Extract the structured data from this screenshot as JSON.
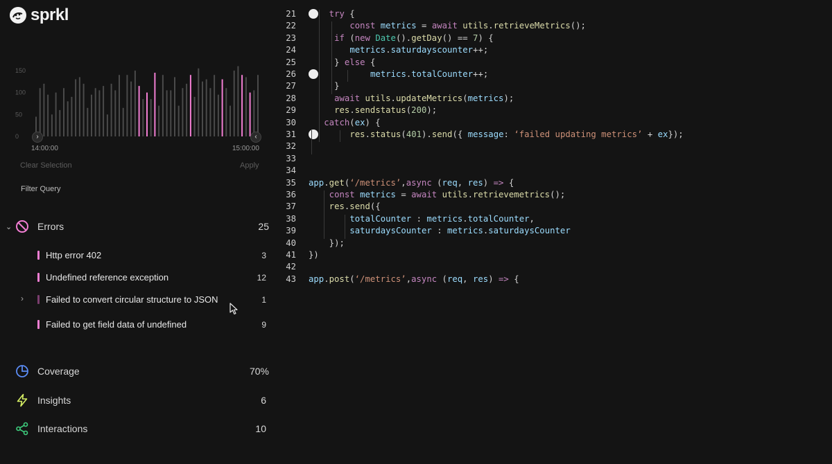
{
  "app": {
    "logo_text": "sprkl"
  },
  "chart_data": {
    "type": "bar",
    "y_ticks": [
      "150",
      "100",
      "50",
      "0"
    ],
    "ylim": [
      0,
      175
    ],
    "x_start_label": "14:00:00",
    "x_end_label": "15:00:00",
    "values": [
      45,
      110,
      120,
      95,
      50,
      100,
      60,
      110,
      80,
      90,
      130,
      135,
      120,
      65,
      95,
      110,
      105,
      115,
      50,
      120,
      105,
      140,
      65,
      140,
      125,
      150,
      115,
      85,
      100,
      85,
      145,
      70,
      140,
      105,
      105,
      135,
      70,
      110,
      120,
      140,
      90,
      155,
      125,
      130,
      110,
      140,
      95,
      130,
      110,
      70,
      150,
      160,
      140,
      135,
      100,
      105,
      140
    ],
    "highlight": [
      false,
      false,
      false,
      false,
      false,
      false,
      false,
      false,
      false,
      false,
      false,
      false,
      false,
      false,
      false,
      false,
      false,
      false,
      false,
      false,
      false,
      false,
      false,
      false,
      false,
      false,
      true,
      false,
      true,
      false,
      true,
      false,
      false,
      false,
      false,
      false,
      false,
      false,
      false,
      true,
      false,
      false,
      false,
      false,
      false,
      false,
      false,
      true,
      false,
      false,
      false,
      false,
      true,
      false,
      true,
      false,
      false
    ],
    "colors": {
      "normal": "#4a4a4a",
      "highlight": "#f27ed3"
    },
    "grid": false,
    "legend": "none"
  },
  "selection": {
    "clear_label": "Clear Selection",
    "apply_label": "Apply"
  },
  "filter": {
    "label": "Filter Query"
  },
  "errors": {
    "label": "Errors",
    "count": "25",
    "items": [
      {
        "label": "Http error 402",
        "count": "3",
        "bar_color": "#f27ed3"
      },
      {
        "label": "Undefined reference exception",
        "count": "12",
        "bar_color": "#f27ed3"
      },
      {
        "label": "Failed to convert circular structure to JSON",
        "count": "1",
        "bar_color": "#7a3d6e"
      },
      {
        "label": "Failed to get field data of undefined",
        "count": "9",
        "bar_color": "#f27ed3"
      }
    ]
  },
  "coverage": {
    "label": "Coverage",
    "value": "70%",
    "icon": "pie-icon",
    "color": "#5b8cf5"
  },
  "insights": {
    "label": "Insights",
    "value": "6",
    "icon": "lightning-icon",
    "color": "#d7f065"
  },
  "interactions": {
    "label": "Interactions",
    "value": "10",
    "icon": "share-icon",
    "color": "#3ecf7e"
  },
  "code": {
    "lines": [
      {
        "n": "21",
        "tokens": [
          [
            "kw",
            "try "
          ],
          [
            "pl",
            "{"
          ]
        ]
      },
      {
        "n": "22",
        "tokens": [
          [
            "kw",
            "const "
          ],
          [
            "vr",
            "metrics "
          ],
          [
            "pl",
            "= "
          ],
          [
            "kw",
            "await "
          ],
          [
            "fn",
            "utils"
          ],
          [
            "pl",
            "."
          ],
          [
            "fn",
            "retrieveMetrics"
          ],
          [
            "pl",
            "();"
          ]
        ]
      },
      {
        "n": "23",
        "tokens": [
          [
            "kw",
            "if "
          ],
          [
            "pl",
            "("
          ],
          [
            "kw",
            "new "
          ],
          [
            "cls",
            "Date"
          ],
          [
            "pl",
            "()."
          ],
          [
            "fn",
            "getDay"
          ],
          [
            "pl",
            "() == "
          ],
          [
            "num",
            "7"
          ],
          [
            "pl",
            ") {"
          ]
        ]
      },
      {
        "n": "24",
        "tokens": [
          [
            "vr",
            "metrics"
          ],
          [
            "pl",
            "."
          ],
          [
            "vr",
            "saturdayscounter"
          ],
          [
            "pl",
            "++;"
          ]
        ]
      },
      {
        "n": "25",
        "tokens": [
          [
            "pl",
            "} "
          ],
          [
            "kw",
            "else "
          ],
          [
            "pl",
            "{"
          ]
        ]
      },
      {
        "n": "26",
        "tokens": [
          [
            "vr",
            "metrics"
          ],
          [
            "pl",
            "."
          ],
          [
            "vr",
            "totalCounter"
          ],
          [
            "pl",
            "++;"
          ]
        ]
      },
      {
        "n": "27",
        "tokens": [
          [
            "pl",
            "}"
          ]
        ]
      },
      {
        "n": "28",
        "tokens": [
          [
            "kw",
            "await "
          ],
          [
            "fn",
            "utils"
          ],
          [
            "pl",
            "."
          ],
          [
            "fn",
            "updateMetrics"
          ],
          [
            "pl",
            "("
          ],
          [
            "vr",
            "metrics"
          ],
          [
            "pl",
            ");"
          ]
        ]
      },
      {
        "n": "29",
        "tokens": [
          [
            "fn",
            "res"
          ],
          [
            "pl",
            "."
          ],
          [
            "fn",
            "sendstatus"
          ],
          [
            "pl",
            "("
          ],
          [
            "num",
            "200"
          ],
          [
            "pl",
            ");"
          ]
        ]
      },
      {
        "n": "30",
        "tokens": [
          [
            "kw",
            "catch"
          ],
          [
            "pl",
            "("
          ],
          [
            "vr",
            "ex"
          ],
          [
            "pl",
            ") {"
          ]
        ]
      },
      {
        "n": "31",
        "tokens": [
          [
            "fn",
            "res"
          ],
          [
            "pl",
            "."
          ],
          [
            "fn",
            "status"
          ],
          [
            "pl",
            "("
          ],
          [
            "num",
            "401"
          ],
          [
            "pl",
            ")."
          ],
          [
            "fn",
            "send"
          ],
          [
            "pl",
            "({ "
          ],
          [
            "vr",
            "message"
          ],
          [
            "pl",
            ": "
          ],
          [
            "str",
            "‘failed updating metrics’"
          ],
          [
            "pl",
            " + "
          ],
          [
            "vr",
            "ex"
          ],
          [
            "pl",
            "});"
          ]
        ]
      },
      {
        "n": "32",
        "tokens": []
      },
      {
        "n": "33",
        "tokens": []
      },
      {
        "n": "34",
        "tokens": []
      },
      {
        "n": "35",
        "tokens": [
          [
            "vr",
            "app"
          ],
          [
            "pl",
            "."
          ],
          [
            "fn",
            "get"
          ],
          [
            "pl",
            "("
          ],
          [
            "str",
            "‘/metrics’"
          ],
          [
            "pl",
            ","
          ],
          [
            "kw",
            "async "
          ],
          [
            "pl",
            "("
          ],
          [
            "vr",
            "req"
          ],
          [
            "pl",
            ", "
          ],
          [
            "vr",
            "res"
          ],
          [
            "pl",
            ") "
          ],
          [
            "kw",
            "=> "
          ],
          [
            "pl",
            "{"
          ]
        ]
      },
      {
        "n": "36",
        "tokens": [
          [
            "kw",
            "const "
          ],
          [
            "vr",
            "metrics "
          ],
          [
            "pl",
            "= "
          ],
          [
            "kw",
            "await "
          ],
          [
            "fn",
            "utils"
          ],
          [
            "pl",
            "."
          ],
          [
            "fn",
            "retrievemetrics"
          ],
          [
            "pl",
            "();"
          ]
        ]
      },
      {
        "n": "37",
        "tokens": [
          [
            "fn",
            "res"
          ],
          [
            "pl",
            "."
          ],
          [
            "fn",
            "send"
          ],
          [
            "pl",
            "({"
          ]
        ]
      },
      {
        "n": "38",
        "tokens": [
          [
            "vr",
            "totalCounter "
          ],
          [
            "pl",
            ": "
          ],
          [
            "vr",
            "metrics"
          ],
          [
            "pl",
            "."
          ],
          [
            "vr",
            "totalCounter"
          ],
          [
            "pl",
            ","
          ]
        ]
      },
      {
        "n": "39",
        "tokens": [
          [
            "vr",
            "saturdaysCounter "
          ],
          [
            "pl",
            ": "
          ],
          [
            "vr",
            "metrics"
          ],
          [
            "pl",
            "."
          ],
          [
            "vr",
            "saturdaysCounter"
          ]
        ]
      },
      {
        "n": "40",
        "tokens": [
          [
            "pl",
            "});"
          ]
        ]
      },
      {
        "n": "41",
        "tokens": [
          [
            "pl",
            "})"
          ]
        ]
      },
      {
        "n": "42",
        "tokens": []
      },
      {
        "n": "43",
        "tokens": [
          [
            "vr",
            "app"
          ],
          [
            "pl",
            "."
          ],
          [
            "fn",
            "post"
          ],
          [
            "pl",
            "("
          ],
          [
            "str",
            "‘/metrics’"
          ],
          [
            "pl",
            ","
          ],
          [
            "kw",
            "async "
          ],
          [
            "pl",
            "("
          ],
          [
            "vr",
            "req"
          ],
          [
            "pl",
            ", "
          ],
          [
            "vr",
            "res"
          ],
          [
            "pl",
            ") "
          ],
          [
            "kw",
            "=> "
          ],
          [
            "pl",
            "{"
          ]
        ]
      }
    ]
  }
}
